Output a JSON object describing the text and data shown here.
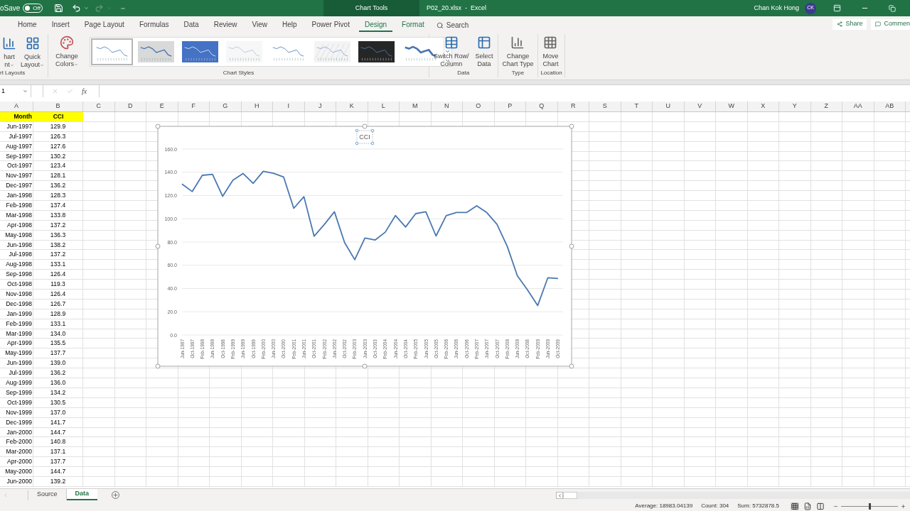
{
  "window": {
    "autosave_label": "oSave",
    "autosave_toggle": "Off",
    "autosave_on": false,
    "redo_disabled": true,
    "contextual_label": "Chart Tools",
    "title": "P02_20.xlsx  -  Excel",
    "user": "Chan Kok Hong",
    "initials": "CK"
  },
  "ribbon_tabs": [
    {
      "label": "Home",
      "selected": false,
      "kind": "normal"
    },
    {
      "label": "Insert",
      "selected": false,
      "kind": "normal"
    },
    {
      "label": "Page Layout",
      "selected": false,
      "kind": "normal"
    },
    {
      "label": "Formulas",
      "selected": false,
      "kind": "normal"
    },
    {
      "label": "Data",
      "selected": false,
      "kind": "normal"
    },
    {
      "label": "Review",
      "selected": false,
      "kind": "normal"
    },
    {
      "label": "View",
      "selected": false,
      "kind": "normal"
    },
    {
      "label": "Help",
      "selected": false,
      "kind": "normal"
    },
    {
      "label": "Power Pivot",
      "selected": false,
      "kind": "normal"
    },
    {
      "label": "Design",
      "selected": true,
      "kind": "contextual"
    },
    {
      "label": "Format",
      "selected": false,
      "kind": "contextual"
    }
  ],
  "search": {
    "placeholder": "Search"
  },
  "share_button": "Share",
  "comments_button": "Commen",
  "ribbon": {
    "layouts": {
      "label": "rt Layouts",
      "buttons": [
        {
          "kind": "add_element",
          "lines": [
            "hart",
            "nt"
          ]
        },
        {
          "kind": "quick_layout",
          "lines": [
            "Quick",
            "Layout"
          ]
        }
      ]
    },
    "styles": {
      "label": "Chart Styles",
      "change_colors": [
        "Change",
        "Colors"
      ],
      "gallery": [
        {
          "kind": "plain",
          "selected": true
        },
        {
          "kind": "gray",
          "selected": false
        },
        {
          "kind": "blue",
          "selected": false
        },
        {
          "kind": "faint",
          "selected": false
        },
        {
          "kind": "plain",
          "selected": false
        },
        {
          "kind": "hatched",
          "selected": false
        },
        {
          "kind": "dark",
          "selected": false
        },
        {
          "kind": "thick",
          "selected": false
        }
      ]
    },
    "groups": [
      {
        "label": "Data",
        "buttons": [
          {
            "kind": "switch",
            "lines": [
              "Switch Row/",
              "Column"
            ]
          },
          {
            "kind": "select_data",
            "lines": [
              "Select",
              "Data"
            ]
          }
        ]
      },
      {
        "label": "Type",
        "buttons": [
          {
            "kind": "chart_type",
            "lines": [
              "Change",
              "Chart Type"
            ]
          }
        ]
      },
      {
        "label": "Location",
        "buttons": [
          {
            "kind": "move",
            "lines": [
              "Move",
              "Chart"
            ]
          }
        ]
      }
    ]
  },
  "formula_bar": {
    "name_box": "1",
    "function_label": "fx"
  },
  "columns": [
    "A",
    "B",
    "C",
    "D",
    "E",
    "F",
    "G",
    "H",
    "I",
    "J",
    "K",
    "L",
    "M",
    "N",
    "O",
    "P",
    "Q",
    "R",
    "S",
    "T",
    "U",
    "V",
    "W",
    "X",
    "Y",
    "Z",
    "AA",
    "AB"
  ],
  "table_header": {
    "col_a": "Month",
    "col_b": "CCI"
  },
  "rows": [
    [
      "Jun-1997",
      "129.9"
    ],
    [
      "Jul-1997",
      "126.3"
    ],
    [
      "Aug-1997",
      "127.6"
    ],
    [
      "Sep-1997",
      "130.2"
    ],
    [
      "Oct-1997",
      "123.4"
    ],
    [
      "Nov-1997",
      "128.1"
    ],
    [
      "Dec-1997",
      "136.2"
    ],
    [
      "Jan-1998",
      "128.3"
    ],
    [
      "Feb-1998",
      "137.4"
    ],
    [
      "Mar-1998",
      "133.8"
    ],
    [
      "Apr-1998",
      "137.2"
    ],
    [
      "May-1998",
      "136.3"
    ],
    [
      "Jun-1998",
      "138.2"
    ],
    [
      "Jul-1998",
      "137.2"
    ],
    [
      "Aug-1998",
      "133.1"
    ],
    [
      "Sep-1998",
      "126.4"
    ],
    [
      "Oct-1998",
      "119.3"
    ],
    [
      "Nov-1998",
      "126.4"
    ],
    [
      "Dec-1998",
      "126.7"
    ],
    [
      "Jan-1999",
      "128.9"
    ],
    [
      "Feb-1999",
      "133.1"
    ],
    [
      "Mar-1999",
      "134.0"
    ],
    [
      "Apr-1999",
      "135.5"
    ],
    [
      "May-1999",
      "137.7"
    ],
    [
      "Jun-1999",
      "139.0"
    ],
    [
      "Jul-1999",
      "136.2"
    ],
    [
      "Aug-1999",
      "136.0"
    ],
    [
      "Sep-1999",
      "134.2"
    ],
    [
      "Oct-1999",
      "130.5"
    ],
    [
      "Nov-1999",
      "137.0"
    ],
    [
      "Dec-1999",
      "141.7"
    ],
    [
      "Jan-2000",
      "144.7"
    ],
    [
      "Feb-2000",
      "140.8"
    ],
    [
      "Mar-2000",
      "137.1"
    ],
    [
      "Apr-2000",
      "137.7"
    ],
    [
      "May-2000",
      "144.7"
    ],
    [
      "Jun-2000",
      "139.2"
    ]
  ],
  "chart": {
    "chart_data": {
      "type": "line",
      "title": "CCI",
      "grid": true,
      "ylim": [
        0,
        160
      ],
      "categories": [
        "Jun-1997",
        "Oct-1997",
        "Feb-1998",
        "Jun-1998",
        "Oct-1998",
        "Feb-1999",
        "Jun-1999",
        "Oct-1999",
        "Feb-2000",
        "Jun-2000",
        "Oct-2000",
        "Feb-2001",
        "Jun-2001",
        "Oct-2001",
        "Feb-2002",
        "Jun-2002",
        "Oct-2002",
        "Feb-2003",
        "Jun-2003",
        "Oct-2003",
        "Feb-2004",
        "Jun-2004",
        "Oct-2004",
        "Feb-2005",
        "Jun-2005",
        "Oct-2005",
        "Feb-2006",
        "Jun-2006",
        "Oct-2006",
        "Feb-2007",
        "Jun-2007",
        "Oct-2007",
        "Feb-2008",
        "Jun-2008",
        "Oct-2008",
        "Feb-2009",
        "Jun-2009",
        "Oct-2009"
      ],
      "yticks": [
        {
          "value": 0,
          "label": "0.0"
        },
        {
          "value": 20,
          "label": "20.0"
        },
        {
          "value": 40,
          "label": "40.0"
        },
        {
          "value": 60,
          "label": "60.0"
        },
        {
          "value": 80,
          "label": "80.0"
        },
        {
          "value": 100,
          "label": "100.0"
        },
        {
          "value": 120,
          "label": "120.0"
        },
        {
          "value": 140,
          "label": "140.0"
        },
        {
          "value": 160,
          "label": "160.0"
        }
      ],
      "series": [
        {
          "color": "#4a78b0",
          "values": [
            129.9,
            123.4,
            137.4,
            138.2,
            119.3,
            133.1,
            139.0,
            130.5,
            140.8,
            139.2,
            136.0,
            109.0,
            119.0,
            85.0,
            95.0,
            106.0,
            79.6,
            64.8,
            83.5,
            81.7,
            88.5,
            102.8,
            92.9,
            104.4,
            106.0,
            85.2,
            102.7,
            105.4,
            105.4,
            111.2,
            105.3,
            95.2,
            76.4,
            51.0,
            38.8,
            25.3,
            49.3,
            48.7
          ]
        }
      ]
    }
  },
  "sheet_tabs": [
    {
      "label": "Source",
      "selected": false
    },
    {
      "label": "Data",
      "selected": true
    }
  ],
  "status_bar": {
    "average": "Average: 18983.04139",
    "count": "Count: 304",
    "sum": "Sum: 5732878.5",
    "views": [
      {
        "kind": "normal",
        "selected": true
      },
      {
        "kind": "page_layout",
        "selected": false
      },
      {
        "kind": "page_break",
        "selected": false
      }
    ],
    "zoom": {
      "level": 0.5
    }
  }
}
